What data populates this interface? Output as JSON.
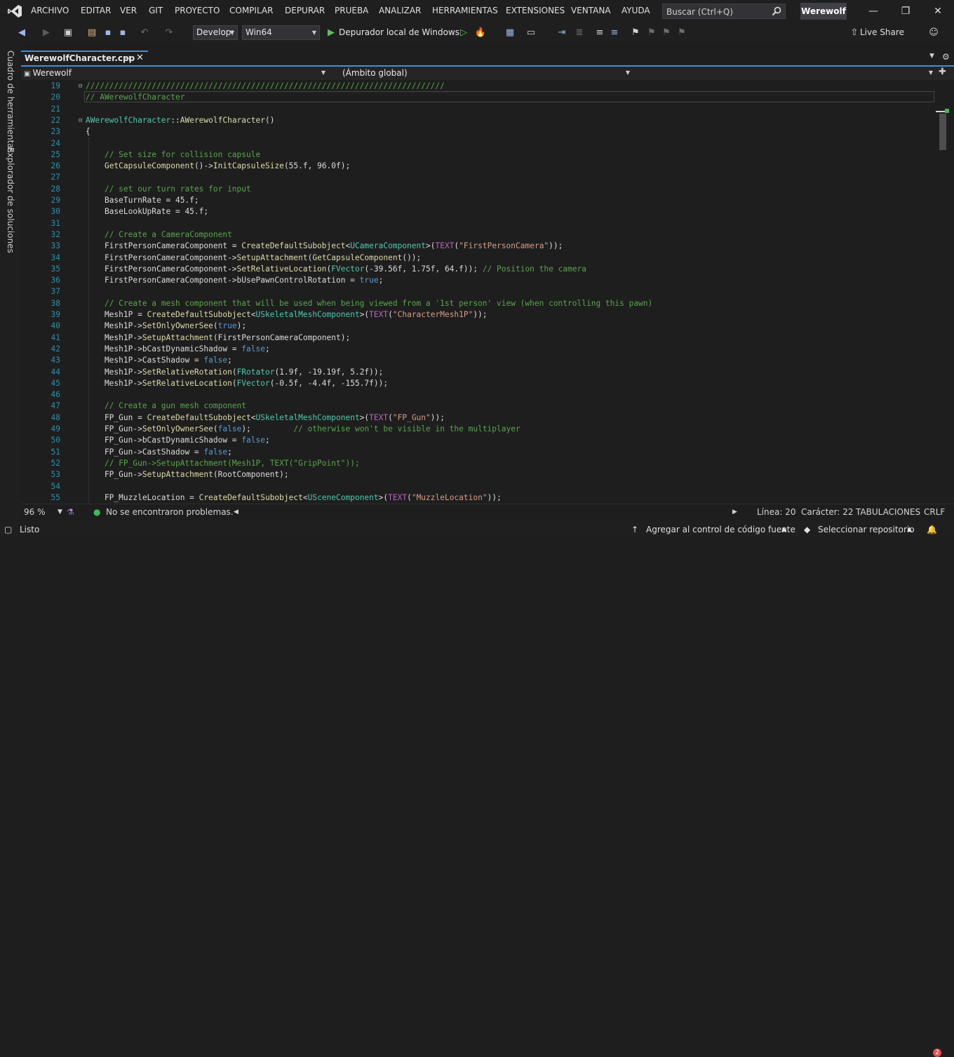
{
  "menu": [
    "ARCHIVO",
    "EDITAR",
    "VER",
    "GIT",
    "PROYECTO",
    "COMPILAR",
    "DEPURAR",
    "PRUEBA",
    "ANALIZAR",
    "HERRAMIENTAS",
    "EXTENSIONES",
    "VENTANA",
    "AYUDA"
  ],
  "search": {
    "placeholder": "Buscar (Ctrl+Q)"
  },
  "solution_name": "Werewolf",
  "toolbar": {
    "config": "Developı",
    "platform": "Win64",
    "run_label": "Depurador local de Windows",
    "live_share": "Live Share"
  },
  "side_tabs": [
    "Cuadro de herramientas",
    "Explorador de soluciones"
  ],
  "tab": {
    "filename": "WerewolfCharacter.cpp"
  },
  "nav": {
    "project": "Werewolf",
    "scope": "(Ámbito global)"
  },
  "code_lines": [
    {
      "n": "19",
      "t": "////////////////////////////////////////////////////////////////////////////"
    },
    {
      "n": "20",
      "t": "// AWerewolfCharacter"
    },
    {
      "n": "21",
      "t": ""
    },
    {
      "n": "22",
      "t": "AWerewolfCharacter::AWerewolfCharacter()"
    },
    {
      "n": "23",
      "t": "{"
    },
    {
      "n": "24",
      "t": ""
    },
    {
      "n": "25",
      "t": "    // Set size for collision capsule"
    },
    {
      "n": "26",
      "t": "    GetCapsuleComponent()->InitCapsuleSize(55.f, 96.0f);"
    },
    {
      "n": "27",
      "t": ""
    },
    {
      "n": "28",
      "t": "    // set our turn rates for input"
    },
    {
      "n": "29",
      "t": "    BaseTurnRate = 45.f;"
    },
    {
      "n": "30",
      "t": "    BaseLookUpRate = 45.f;"
    },
    {
      "n": "31",
      "t": ""
    },
    {
      "n": "32",
      "t": "    // Create a CameraComponent"
    },
    {
      "n": "33",
      "t": "    FirstPersonCameraComponent = CreateDefaultSubobject<UCameraComponent>(TEXT(\"FirstPersonCamera\"));"
    },
    {
      "n": "34",
      "t": "    FirstPersonCameraComponent->SetupAttachment(GetCapsuleComponent());"
    },
    {
      "n": "35",
      "t": "    FirstPersonCameraComponent->SetRelativeLocation(FVector(-39.56f, 1.75f, 64.f)); // Position the camera"
    },
    {
      "n": "36",
      "t": "    FirstPersonCameraComponent->bUsePawnControlRotation = true;"
    },
    {
      "n": "37",
      "t": ""
    },
    {
      "n": "38",
      "t": "    // Create a mesh component that will be used when being viewed from a '1st person' view (when controlling this pawn)"
    },
    {
      "n": "39",
      "t": "    Mesh1P = CreateDefaultSubobject<USkeletalMeshComponent>(TEXT(\"CharacterMesh1P\"));"
    },
    {
      "n": "40",
      "t": "    Mesh1P->SetOnlyOwnerSee(true);"
    },
    {
      "n": "41",
      "t": "    Mesh1P->SetupAttachment(FirstPersonCameraComponent);"
    },
    {
      "n": "42",
      "t": "    Mesh1P->bCastDynamicShadow = false;"
    },
    {
      "n": "43",
      "t": "    Mesh1P->CastShadow = false;"
    },
    {
      "n": "44",
      "t": "    Mesh1P->SetRelativeRotation(FRotator(1.9f, -19.19f, 5.2f));"
    },
    {
      "n": "45",
      "t": "    Mesh1P->SetRelativeLocation(FVector(-0.5f, -4.4f, -155.7f));"
    },
    {
      "n": "46",
      "t": ""
    },
    {
      "n": "47",
      "t": "    // Create a gun mesh component"
    },
    {
      "n": "48",
      "t": "    FP_Gun = CreateDefaultSubobject<USkeletalMeshComponent>(TEXT(\"FP_Gun\"));"
    },
    {
      "n": "49",
      "t": "    FP_Gun->SetOnlyOwnerSee(false);         // otherwise won't be visible in the multiplayer"
    },
    {
      "n": "50",
      "t": "    FP_Gun->bCastDynamicShadow = false;"
    },
    {
      "n": "51",
      "t": "    FP_Gun->CastShadow = false;"
    },
    {
      "n": "52",
      "t": "    // FP_Gun->SetupAttachment(Mesh1P, TEXT(\"GripPoint\"));"
    },
    {
      "n": "53",
      "t": "    FP_Gun->SetupAttachment(RootComponent);"
    },
    {
      "n": "54",
      "t": ""
    },
    {
      "n": "55",
      "t": "    FP_MuzzleLocation = CreateDefaultSubobject<USceneComponent>(TEXT(\"MuzzleLocation\"));"
    }
  ],
  "editor_status": {
    "zoom": "96 %",
    "problems": "No se encontraron problemas.",
    "line": "Línea: 20",
    "char": "Carácter: 22",
    "indent": "TABULACIONES",
    "eol": "CRLF"
  },
  "statusbar": {
    "ready": "Listo",
    "source_control": "Agregar al control de código fuente",
    "repo": "Seleccionar repositorio",
    "notifications": "2"
  },
  "colors": {
    "accent": "#3f8fd6",
    "comment": "#57a64a",
    "function": "#dcdcaa",
    "type": "#4ec9b0",
    "keyword": "#569cd6",
    "string": "#d69d85",
    "macro": "#bd63c5",
    "line_number": "#2b91af"
  }
}
